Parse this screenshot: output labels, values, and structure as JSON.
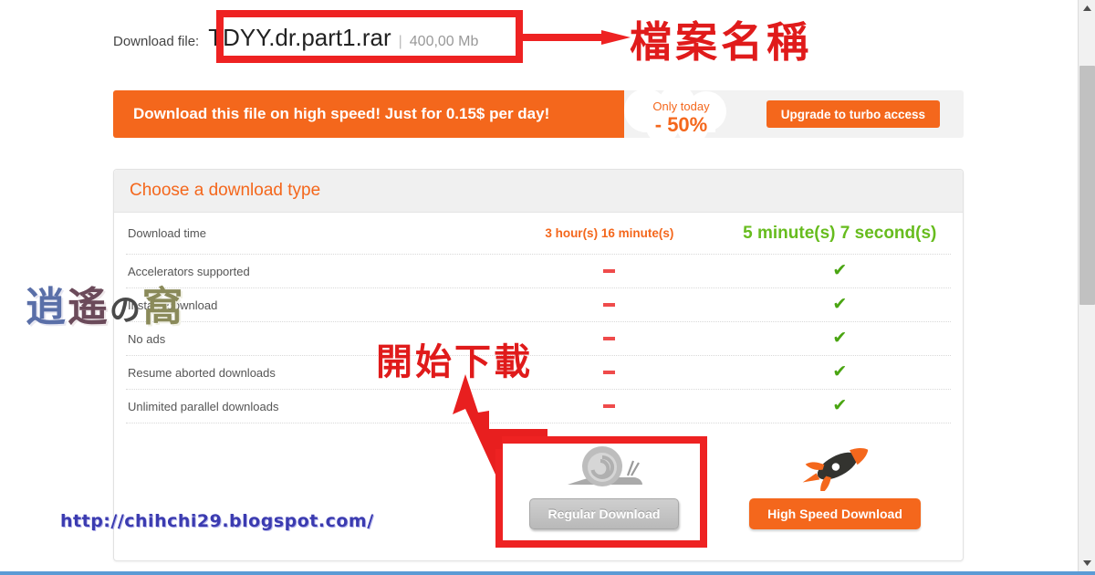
{
  "file_info": {
    "label": "Download file:",
    "name": "TDYY.dr.part1.rar",
    "separator": "|",
    "size": "400,00 Mb"
  },
  "promo": {
    "text": "Download this file on high speed! Just for 0.15$ per day!",
    "badge_line1": "Only today",
    "badge_line2": "- 50%",
    "upgrade_label": "Upgrade to turbo access"
  },
  "panel": {
    "title": "Choose a download type",
    "rows": [
      {
        "label": "Download time",
        "regular": "3 hour(s) 16 minute(s)",
        "premium": "5 minute(s) 7 second(s)",
        "type": "time"
      },
      {
        "label": "Accelerators supported",
        "regular": "–",
        "premium": "✔",
        "type": "mark"
      },
      {
        "label": "Instant download",
        "regular": "–",
        "premium": "✔",
        "type": "mark"
      },
      {
        "label": "No ads",
        "regular": "–",
        "premium": "✔",
        "type": "mark"
      },
      {
        "label": "Resume aborted downloads",
        "regular": "–",
        "premium": "✔",
        "type": "mark"
      },
      {
        "label": "Unlimited parallel downloads",
        "regular": "–",
        "premium": "✔",
        "type": "mark"
      }
    ],
    "regular_button": "Regular Download",
    "premium_button": "High Speed Download",
    "regular_icon": "snail-icon",
    "premium_icon": "rocket-icon"
  },
  "annotations": {
    "filename_note": "檔案名稱",
    "download_note": "開始下載",
    "box_color": "#ee2222",
    "text_color": "#e01b1b"
  },
  "watermark": {
    "logo_chars": [
      {
        "char": "逍",
        "color": "#5a6fa8"
      },
      {
        "char": "遙",
        "color": "#6b4a5a"
      },
      {
        "char": "の",
        "color": "#4a4a4a"
      },
      {
        "char": "窩",
        "color": "#8a8a5a"
      }
    ],
    "url": "http://chihchi29.blogspot.com/"
  },
  "colors": {
    "accent_orange": "#f4671c",
    "green": "#67bc1e",
    "red_dash": "#ef4b4b",
    "panel_header": "#f0f0f0"
  },
  "scrollbar": {
    "up_arrow": "▲",
    "down_arrow": "▼"
  }
}
